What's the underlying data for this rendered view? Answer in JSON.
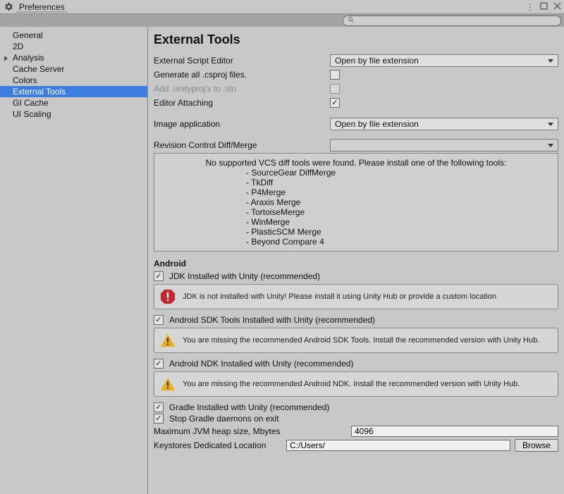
{
  "window": {
    "title": "Preferences"
  },
  "sidebar": {
    "items": [
      {
        "label": "General",
        "expandable": false
      },
      {
        "label": "2D",
        "expandable": false
      },
      {
        "label": "Analysis",
        "expandable": true
      },
      {
        "label": "Cache Server",
        "expandable": false
      },
      {
        "label": "Colors",
        "expandable": false
      },
      {
        "label": "External Tools",
        "expandable": false,
        "selected": true
      },
      {
        "label": "GI Cache",
        "expandable": false
      },
      {
        "label": "UI Scaling",
        "expandable": false
      }
    ]
  },
  "main": {
    "title": "External Tools",
    "rows": {
      "script_editor_label": "External Script Editor",
      "script_editor_value": "Open by file extension",
      "generate_csproj_label": "Generate all .csproj files.",
      "add_unityproj_label": "Add .unityproj's to .sln",
      "editor_attaching_label": "Editor Attaching",
      "image_app_label": "Image application",
      "image_app_value": "Open by file extension",
      "revision_label": "Revision Control Diff/Merge",
      "revision_value": ""
    },
    "vcs_box": {
      "intro": "No supported VCS diff tools were found. Please install one of the following tools:",
      "tools": [
        "SourceGear DiffMerge",
        "TkDiff",
        "P4Merge",
        "Araxis Merge",
        "TortoiseMerge",
        "WinMerge",
        "PlasticSCM Merge",
        "Beyond Compare 4"
      ]
    },
    "android": {
      "heading": "Android",
      "jdk_label": "JDK Installed with Unity (recommended)",
      "jdk_alert": "JDK is not installed with Unity! Please install it using Unity Hub or provide a custom location",
      "sdk_label": "Android SDK Tools Installed with Unity (recommended)",
      "sdk_alert": "You are missing the recommended Android SDK Tools. Install the recommended version with Unity Hub.",
      "ndk_label": "Android NDK Installed with Unity (recommended)",
      "ndk_alert": "You are missing the recommended Android NDK. Install the recommended version with Unity Hub.",
      "gradle_label": "Gradle Installed with Unity (recommended)",
      "stop_gradle_label": "Stop Gradle daemons on exit",
      "heap_label": "Maximum JVM heap size, Mbytes",
      "heap_value": "4096",
      "keystore_label": "Keystores Dedicated Location",
      "keystore_value": "C:/Users/",
      "browse_label": "Browse"
    }
  }
}
